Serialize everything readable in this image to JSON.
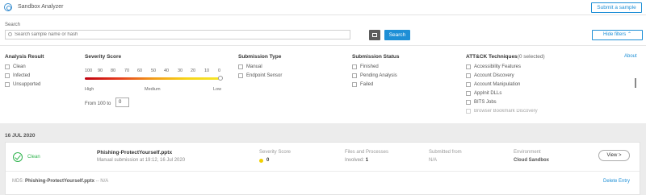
{
  "header": {
    "app_title": "Sandbox Analyzer",
    "submit_label": "Submit a sample"
  },
  "search": {
    "label": "Search",
    "placeholder": "Search sample name or hash",
    "button_label": "Search",
    "hide_filters_label": "Hide filters"
  },
  "filters": {
    "analysis_result": {
      "title": "Analysis Result",
      "options": [
        "Clean",
        "Infected",
        "Unsupported"
      ]
    },
    "severity": {
      "title": "Severity Score",
      "scale": [
        "100",
        "90",
        "80",
        "70",
        "60",
        "50",
        "40",
        "30",
        "20",
        "10",
        "0"
      ],
      "high_label": "High",
      "medium_label": "Medium",
      "low_label": "Low",
      "from_label": "From 100 to",
      "to_value": "0"
    },
    "submission_type": {
      "title": "Submission Type",
      "options": [
        "Manual",
        "Endpoint Sensor"
      ]
    },
    "submission_status": {
      "title": "Submission Status",
      "options": [
        "Finished",
        "Pending Analysis",
        "Failed"
      ]
    },
    "attack": {
      "title": "ATT&CK Techniques",
      "selected_note": "(0 selected)",
      "about_label": "About",
      "options": [
        "Accessibility Features",
        "Account Discovery",
        "Account Manipulation",
        "AppInit DLLs",
        "BITS Jobs",
        "Browser Bookmark Discovery"
      ]
    }
  },
  "results": {
    "date_header": "16 JUL 2020",
    "entry": {
      "status": "Clean",
      "status_color": "#2fb34d",
      "file_name": "Phishing-ProtectYourself.pptx",
      "submission_note": "Manual submission at 19:12, 16 Jul 2020",
      "severity_label": "Severity Score",
      "severity_value": "0",
      "files_label": "Files and Processes",
      "files_value_prefix": "Involved:",
      "files_value": "1",
      "submitted_from_label": "Submitted from",
      "submitted_from_value": "N/A",
      "environment_label": "Environment",
      "environment_value": "Cloud Sandbox",
      "view_label": "View >",
      "md5_label": "MD5:",
      "md5_file": "Phishing-ProtectYourself.pptx",
      "md5_value": "-- N/A",
      "delete_label": "Delete Entry"
    }
  },
  "colors": {
    "accent": "#1e8fd6",
    "clean": "#2fb34d",
    "severity_dot": "#f2d000"
  }
}
